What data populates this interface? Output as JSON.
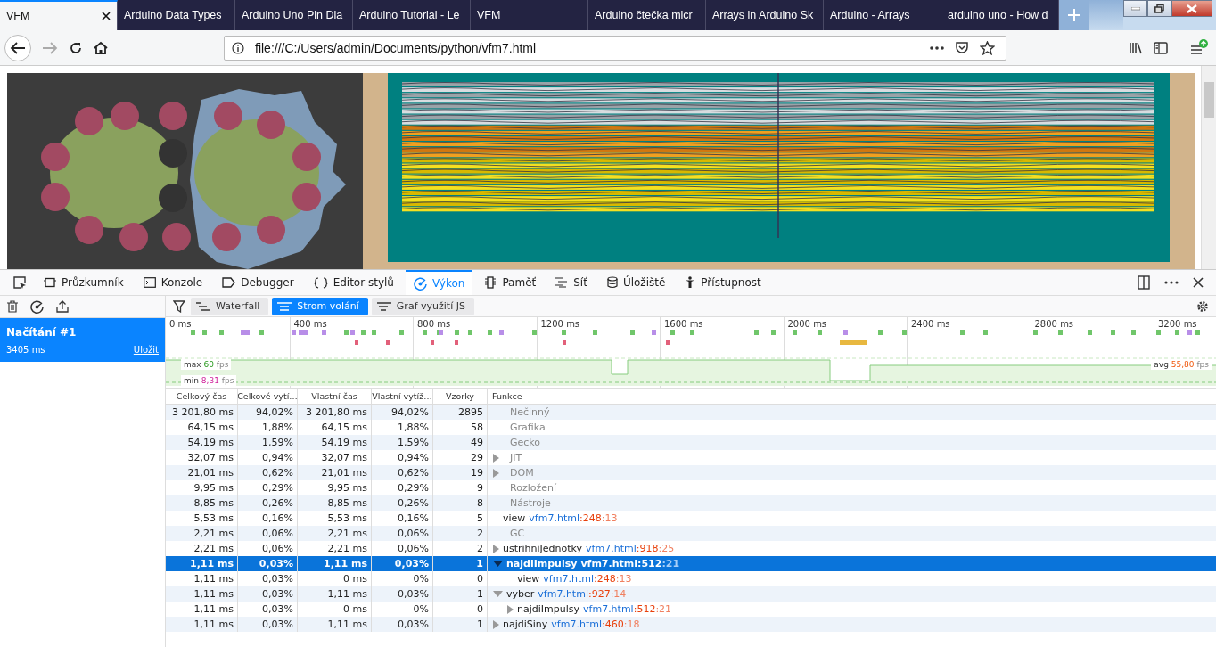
{
  "browser": {
    "tabs": [
      {
        "title": "VFM",
        "selected": true
      },
      {
        "title": "Arduino Data Types",
        "selected": false
      },
      {
        "title": "Arduino Uno Pin Dia",
        "selected": false
      },
      {
        "title": "Arduino Tutorial - Le",
        "selected": false
      },
      {
        "title": "VFM",
        "selected": false
      },
      {
        "title": "Arduino čtečka micr",
        "selected": false
      },
      {
        "title": "Arrays in Arduino Sk",
        "selected": false
      },
      {
        "title": "Arduino - Arrays",
        "selected": false
      },
      {
        "title": "arduino uno - How d",
        "selected": false
      }
    ],
    "url": "file:///C:/Users/admin/Documents/python/vfm7.html"
  },
  "devtools": {
    "tabs": [
      {
        "label": "Průzkumník",
        "selected": false
      },
      {
        "label": "Konzole",
        "selected": false
      },
      {
        "label": "Debugger",
        "selected": false
      },
      {
        "label": "Editor stylů",
        "selected": false
      },
      {
        "label": "Výkon",
        "selected": true
      },
      {
        "label": "Paměť",
        "selected": false
      },
      {
        "label": "Síť",
        "selected": false
      },
      {
        "label": "Úložiště",
        "selected": false
      },
      {
        "label": "Přístupnost",
        "selected": false
      }
    ]
  },
  "recordings": [
    {
      "title": "Načítání #1",
      "duration": "3405 ms",
      "save_link": "Uložit",
      "selected": true
    }
  ],
  "views": [
    {
      "label": "Waterfall",
      "selected": false
    },
    {
      "label": "Strom volání",
      "selected": true
    },
    {
      "label": "Graf využití JS",
      "selected": false
    }
  ],
  "timeline": {
    "ticks": [
      "0 ms",
      "400 ms",
      "800 ms",
      "1200 ms",
      "1600 ms",
      "2000 ms",
      "2400 ms",
      "2800 ms",
      "3200 ms"
    ],
    "max": {
      "label": "max",
      "value": "60",
      "unit": "fps"
    },
    "min": {
      "label": "min",
      "value": "8,31",
      "unit": "fps"
    },
    "avg": {
      "label": "avg",
      "value": "55,80",
      "unit": "fps"
    }
  },
  "table": {
    "columns": [
      "Celkový čas",
      "Celkové vytí…",
      "Vlastní čas",
      "Vlastní vytíž…",
      "Vzorky",
      "Funkce"
    ],
    "rows": [
      {
        "total": "3 201,80 ms",
        "total_pct": "94,02%",
        "self": "3 201,80 ms",
        "self_pct": "94,02%",
        "samples": "2895",
        "kind": "category",
        "name": "Nečinný",
        "selected": false
      },
      {
        "total": "64,15 ms",
        "total_pct": "1,88%",
        "self": "64,15 ms",
        "self_pct": "1,88%",
        "samples": "58",
        "kind": "category",
        "name": "Grafika",
        "selected": false
      },
      {
        "total": "54,19 ms",
        "total_pct": "1,59%",
        "self": "54,19 ms",
        "self_pct": "1,59%",
        "samples": "49",
        "kind": "category",
        "name": "Gecko",
        "selected": false
      },
      {
        "total": "32,07 ms",
        "total_pct": "0,94%",
        "self": "32,07 ms",
        "self_pct": "0,94%",
        "samples": "29",
        "kind": "category",
        "name": "JIT",
        "expanded": false,
        "selected": false
      },
      {
        "total": "21,01 ms",
        "total_pct": "0,62%",
        "self": "21,01 ms",
        "self_pct": "0,62%",
        "samples": "19",
        "kind": "category",
        "name": "DOM",
        "expanded": false,
        "selected": false
      },
      {
        "total": "9,95 ms",
        "total_pct": "0,29%",
        "self": "9,95 ms",
        "self_pct": "0,29%",
        "samples": "9",
        "kind": "category",
        "name": "Rozložení",
        "selected": false
      },
      {
        "total": "8,85 ms",
        "total_pct": "0,26%",
        "self": "8,85 ms",
        "self_pct": "0,26%",
        "samples": "8",
        "kind": "category",
        "name": "Nástroje",
        "selected": false
      },
      {
        "total": "5,53 ms",
        "total_pct": "0,16%",
        "self": "5,53 ms",
        "self_pct": "0,16%",
        "samples": "5",
        "kind": "js",
        "name": "view",
        "file": "vfm7.html",
        "line": ":248",
        "column": ":13",
        "selected": false
      },
      {
        "total": "2,21 ms",
        "total_pct": "0,06%",
        "self": "2,21 ms",
        "self_pct": "0,06%",
        "samples": "2",
        "kind": "category",
        "name": "GC",
        "selected": false
      },
      {
        "total": "2,21 ms",
        "total_pct": "0,06%",
        "self": "2,21 ms",
        "self_pct": "0,06%",
        "samples": "2",
        "kind": "js",
        "name": "ustrihniJednotky",
        "file": "vfm7.html",
        "line": ":918",
        "column": ":25",
        "expanded": false,
        "selected": false
      },
      {
        "total": "1,11 ms",
        "total_pct": "0,03%",
        "self": "1,11 ms",
        "self_pct": "0,03%",
        "samples": "1",
        "kind": "js",
        "name": "najdiImpulsy",
        "file": "vfm7.html",
        "line": ":512",
        "column": ":21",
        "expanded": true,
        "selected": true,
        "children": [
          {
            "total": "1,11 ms",
            "total_pct": "0,03%",
            "self": "0 ms",
            "self_pct": "0%",
            "samples": "0",
            "kind": "js",
            "name": "view",
            "file": "vfm7.html",
            "line": ":248",
            "column": ":13",
            "selected": false
          }
        ]
      },
      {
        "total": "1,11 ms",
        "total_pct": "0,03%",
        "self": "1,11 ms",
        "self_pct": "0,03%",
        "samples": "1",
        "kind": "js",
        "name": "vyber",
        "file": "vfm7.html",
        "line": ":927",
        "column": ":14",
        "expanded": true,
        "selected": false,
        "children": [
          {
            "total": "1,11 ms",
            "total_pct": "0,03%",
            "self": "0 ms",
            "self_pct": "0%",
            "samples": "0",
            "kind": "js",
            "name": "najdiImpulsy",
            "file": "vfm7.html",
            "line": ":512",
            "column": ":21",
            "expanded": false,
            "selected": false
          }
        ]
      },
      {
        "total": "1,11 ms",
        "total_pct": "0,03%",
        "self": "1,11 ms",
        "self_pct": "0,03%",
        "samples": "1",
        "kind": "js",
        "name": "najdiSiny",
        "file": "vfm7.html",
        "line": ":460",
        "column": ":18",
        "expanded": false,
        "selected": false
      }
    ]
  }
}
